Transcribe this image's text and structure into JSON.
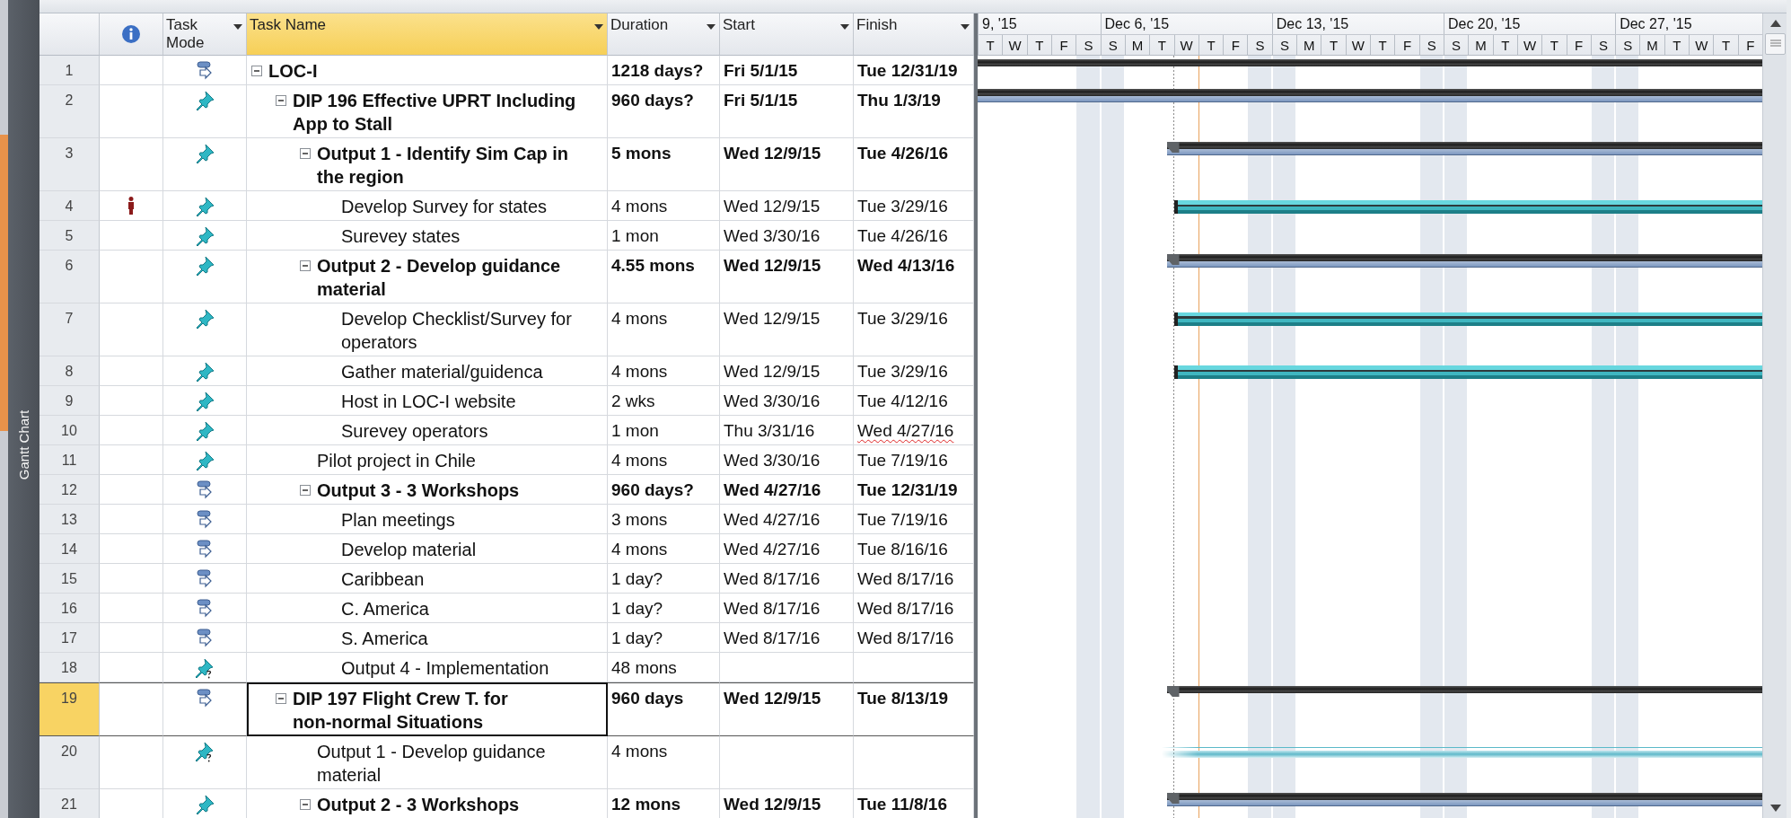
{
  "view_bar": {
    "label": "Gantt Chart"
  },
  "columns": [
    {
      "kind": "indicators",
      "highlighted": false
    },
    {
      "kind": "text",
      "label": "Task Mode",
      "highlighted": false
    },
    {
      "kind": "text",
      "label": "Task Name",
      "highlighted": true
    },
    {
      "kind": "text",
      "label": "Duration",
      "highlighted": false
    },
    {
      "kind": "text",
      "label": "Start",
      "highlighted": false
    },
    {
      "kind": "text",
      "label": "Finish",
      "highlighted": false
    }
  ],
  "timescale": {
    "weeks": [
      {
        "label": "9, '15",
        "days": [
          {
            "label": "T",
            "weekend": false
          },
          {
            "label": "W",
            "weekend": false
          },
          {
            "label": "T",
            "weekend": false
          },
          {
            "label": "F",
            "weekend": false
          },
          {
            "label": "S",
            "weekend": true
          }
        ]
      },
      {
        "label": "Dec 6, '15",
        "days": [
          {
            "label": "S",
            "weekend": true
          },
          {
            "label": "M",
            "weekend": false
          },
          {
            "label": "T",
            "weekend": false
          },
          {
            "label": "W",
            "weekend": false
          },
          {
            "label": "T",
            "weekend": false
          },
          {
            "label": "F",
            "weekend": false
          },
          {
            "label": "S",
            "weekend": true
          }
        ]
      },
      {
        "label": "Dec 13, '15",
        "days": [
          {
            "label": "S",
            "weekend": true
          },
          {
            "label": "M",
            "weekend": false
          },
          {
            "label": "T",
            "weekend": false
          },
          {
            "label": "W",
            "weekend": false
          },
          {
            "label": "T",
            "weekend": false
          },
          {
            "label": "F",
            "weekend": false
          },
          {
            "label": "S",
            "weekend": true
          }
        ]
      },
      {
        "label": "Dec 20, '15",
        "days": [
          {
            "label": "S",
            "weekend": true
          },
          {
            "label": "M",
            "weekend": false
          },
          {
            "label": "T",
            "weekend": false
          },
          {
            "label": "W",
            "weekend": false
          },
          {
            "label": "T",
            "weekend": false
          },
          {
            "label": "F",
            "weekend": false
          },
          {
            "label": "S",
            "weekend": true
          }
        ]
      },
      {
        "label": "Dec 27, '15",
        "days": [
          {
            "label": "S",
            "weekend": true
          },
          {
            "label": "M",
            "weekend": false
          },
          {
            "label": "T",
            "weekend": false
          },
          {
            "label": "W",
            "weekend": false
          },
          {
            "label": "T",
            "weekend": false
          },
          {
            "label": "F",
            "weekend": false
          }
        ]
      }
    ]
  },
  "tasks": [
    {
      "id": "1",
      "kind": "auto",
      "name": "LOC-I",
      "duration": "1218 days?",
      "start": "Fri 5/1/15",
      "finish": "Tue 12/31/19",
      "indicator": false,
      "finish_flagged": false,
      "selected": false,
      "bar": {
        "kind": "summary",
        "in_view": false
      },
      "expanded": true,
      "children": [
        {
          "id": "2",
          "kind": "manual",
          "name": "DIP 196 Effective UPRT Including App to Stall",
          "duration": "960 days?",
          "start": "Fri 5/1/15",
          "finish": "Thu 1/3/19",
          "indicator": false,
          "finish_flagged": false,
          "selected": false,
          "bar": {
            "kind": "summary",
            "in_view": false
          },
          "expanded": true,
          "children": [
            {
              "id": "3",
              "kind": "manual",
              "name": "Output 1 - Identify Sim Cap in the region",
              "duration": "5 mons",
              "start": "Wed 12/9/15",
              "finish": "Tue 4/26/16",
              "indicator": false,
              "finish_flagged": false,
              "selected": false,
              "bar": {
                "kind": "summary",
                "in_view": true
              },
              "expanded": true,
              "children": [
                {
                  "id": "4",
                  "kind": "manual",
                  "name": "Develop Survey for states",
                  "duration": "4 mons",
                  "start": "Wed 12/9/15",
                  "finish": "Tue 3/29/16",
                  "indicator": true,
                  "finish_flagged": false,
                  "selected": false,
                  "bar": {
                    "kind": "task",
                    "in_view": true
                  }
                },
                {
                  "id": "5",
                  "kind": "manual",
                  "name": "Surevey states",
                  "duration": "1 mon",
                  "start": "Wed 3/30/16",
                  "finish": "Tue 4/26/16",
                  "indicator": false,
                  "finish_flagged": false,
                  "selected": false
                }
              ]
            },
            {
              "id": "6",
              "kind": "manual",
              "name": "Output 2 - Develop guidance material",
              "duration": "4.55 mons",
              "start": "Wed 12/9/15",
              "finish": "Wed 4/13/16",
              "indicator": false,
              "finish_flagged": false,
              "selected": false,
              "bar": {
                "kind": "summary",
                "in_view": true
              },
              "expanded": true,
              "children": [
                {
                  "id": "7",
                  "kind": "manual",
                  "name": "Develop Checklist/Survey for operators",
                  "duration": "4 mons",
                  "start": "Wed 12/9/15",
                  "finish": "Tue 3/29/16",
                  "indicator": false,
                  "finish_flagged": false,
                  "selected": false,
                  "bar": {
                    "kind": "task",
                    "in_view": true
                  }
                },
                {
                  "id": "8",
                  "kind": "manual",
                  "name": "Gather material/guidenca",
                  "duration": "4 mons",
                  "start": "Wed 12/9/15",
                  "finish": "Tue 3/29/16",
                  "indicator": false,
                  "finish_flagged": false,
                  "selected": false,
                  "bar": {
                    "kind": "task",
                    "in_view": true
                  }
                },
                {
                  "id": "9",
                  "kind": "manual",
                  "name": "Host in LOC-I website",
                  "duration": "2 wks",
                  "start": "Wed 3/30/16",
                  "finish": "Tue 4/12/16",
                  "indicator": false,
                  "finish_flagged": false,
                  "selected": false
                },
                {
                  "id": "10",
                  "kind": "manual",
                  "name": "Surevey operators",
                  "duration": "1 mon",
                  "start": "Thu 3/31/16",
                  "finish": "Wed 4/27/16",
                  "indicator": false,
                  "finish_flagged": true,
                  "selected": false
                }
              ]
            },
            {
              "id": "11",
              "kind": "manual",
              "name": "Pilot project in Chile",
              "duration": "4 mons",
              "start": "Wed 3/30/16",
              "finish": "Tue 7/19/16",
              "indicator": false,
              "finish_flagged": false,
              "selected": false
            },
            {
              "id": "12",
              "kind": "auto",
              "name": "Output 3 - 3 Workshops",
              "duration": "960 days?",
              "start": "Wed 4/27/16",
              "finish": "Tue 12/31/19",
              "indicator": false,
              "finish_flagged": false,
              "selected": false,
              "expanded": true,
              "children": [
                {
                  "id": "13",
                  "kind": "auto",
                  "name": "Plan meetings",
                  "duration": "3 mons",
                  "start": "Wed 4/27/16",
                  "finish": "Tue 7/19/16",
                  "indicator": false,
                  "finish_flagged": false,
                  "selected": false
                },
                {
                  "id": "14",
                  "kind": "auto",
                  "name": "Develop material",
                  "duration": "4 mons",
                  "start": "Wed 4/27/16",
                  "finish": "Tue 8/16/16",
                  "indicator": false,
                  "finish_flagged": false,
                  "selected": false
                },
                {
                  "id": "15",
                  "kind": "auto",
                  "name": "Caribbean",
                  "duration": "1 day?",
                  "start": "Wed 8/17/16",
                  "finish": "Wed 8/17/16",
                  "indicator": false,
                  "finish_flagged": false,
                  "selected": false
                },
                {
                  "id": "16",
                  "kind": "auto",
                  "name": "C. America",
                  "duration": "1 day?",
                  "start": "Wed 8/17/16",
                  "finish": "Wed 8/17/16",
                  "indicator": false,
                  "finish_flagged": false,
                  "selected": false
                },
                {
                  "id": "17",
                  "kind": "auto",
                  "name": "S. America",
                  "duration": "1 day?",
                  "start": "Wed 8/17/16",
                  "finish": "Wed 8/17/16",
                  "indicator": false,
                  "finish_flagged": false,
                  "selected": false
                },
                {
                  "id": "18",
                  "kind": "estimated",
                  "name": "Output 4 - Implementation",
                  "duration": "48 mons",
                  "indicator": false,
                  "finish_flagged": false,
                  "selected": false
                }
              ]
            }
          ]
        },
        {
          "id": "19",
          "kind": "auto",
          "name": "DIP 197 Flight Crew T. for non-normal Situations",
          "duration": "960 days",
          "start": "Wed 12/9/15",
          "finish": "Tue 8/13/19",
          "indicator": false,
          "finish_flagged": false,
          "selected": true,
          "bar": {
            "kind": "summary",
            "in_view": true
          },
          "expanded": true,
          "children": [
            {
              "id": "20",
              "kind": "estimated",
              "name": "Output 1 - Develop guidance material",
              "duration": "4 mons",
              "indicator": false,
              "finish_flagged": false,
              "selected": false,
              "bar": {
                "kind": "estimated",
                "in_view": true
              }
            },
            {
              "id": "21",
              "kind": "manual",
              "name": "Output 2 - 3 Workshops",
              "duration": "12 mons",
              "start": "Wed 12/9/15",
              "finish": "Tue 11/8/16",
              "indicator": false,
              "finish_flagged": false,
              "selected": false,
              "bar": {
                "kind": "summary",
                "in_view": true
              },
              "expanded": true
            }
          ]
        }
      ]
    }
  ]
}
